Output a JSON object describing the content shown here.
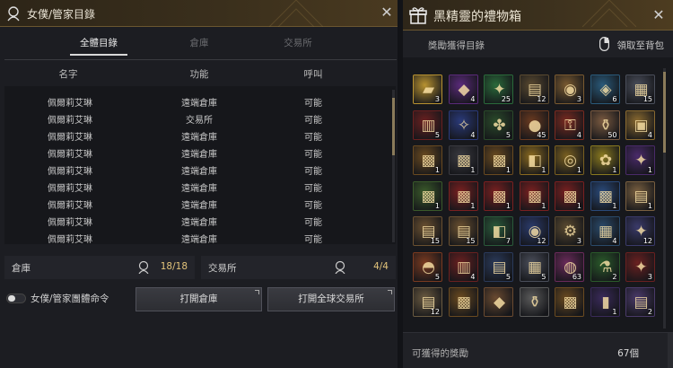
{
  "left_panel": {
    "title": "女僕/管家目錄",
    "close_label": "✕",
    "tabs": [
      {
        "label": "全體目錄",
        "active": true
      },
      {
        "label": "倉庫",
        "active": false
      },
      {
        "label": "交易所",
        "active": false
      }
    ],
    "columns": [
      "名字",
      "功能",
      "呼叫"
    ],
    "rows": [
      {
        "name": "佩爾莉艾琳",
        "function": "遠端倉庫",
        "call": "可能"
      },
      {
        "name": "佩爾莉艾琳",
        "function": "交易所",
        "call": "可能"
      },
      {
        "name": "佩爾莉艾琳",
        "function": "遠端倉庫",
        "call": "可能"
      },
      {
        "name": "佩爾莉艾琳",
        "function": "遠端倉庫",
        "call": "可能"
      },
      {
        "name": "佩爾莉艾琳",
        "function": "遠端倉庫",
        "call": "可能"
      },
      {
        "name": "佩爾莉艾琳",
        "function": "遠端倉庫",
        "call": "可能"
      },
      {
        "name": "佩爾莉艾琳",
        "function": "遠端倉庫",
        "call": "可能"
      },
      {
        "name": "佩爾莉艾琳",
        "function": "遠端倉庫",
        "call": "可能"
      },
      {
        "name": "佩爾莉艾琳",
        "function": "遠端倉庫",
        "call": "可能"
      }
    ],
    "storage_stat": {
      "label": "倉庫",
      "value": "18/18"
    },
    "market_stat": {
      "label": "交易所",
      "value": "4/4"
    },
    "toggle_label": "女僕/管家團體命令",
    "toggle_on": false,
    "open_storage_button": "打開倉庫",
    "open_market_button": "打開全球交易所"
  },
  "right_panel": {
    "title": "黑精靈的禮物箱",
    "close_label": "✕",
    "subtitle": "獎勵獲得目錄",
    "collect_label": "領取至背包",
    "footer_label": "可獲得的獎勵",
    "footer_count": "67個",
    "items": [
      {
        "icon": "gold-bar-icon",
        "count": "3",
        "color": "#b89230",
        "sym": "▰"
      },
      {
        "icon": "purple-pouch-icon",
        "count": "4",
        "color": "#5a2a7a",
        "sym": "◆"
      },
      {
        "icon": "green-crystal-icon",
        "count": "25",
        "color": "#2a6a3a",
        "sym": "✦"
      },
      {
        "icon": "scroll-icon",
        "count": "12",
        "color": "#5a4a30",
        "sym": "▤"
      },
      {
        "icon": "food-tray-icon",
        "count": "3",
        "color": "#7a5a30",
        "sym": "◉"
      },
      {
        "icon": "blue-gem-icon",
        "count": "6",
        "color": "#2a5a7a",
        "sym": "◈"
      },
      {
        "icon": "silver-chest-icon",
        "count": "15",
        "color": "#4a4e5a",
        "sym": "▦"
      },
      {
        "icon": "red-book-icon",
        "count": "5",
        "color": "#6a2020",
        "sym": "▥"
      },
      {
        "icon": "butterfly-icon",
        "count": "4",
        "color": "#2a3a7a",
        "sym": "✧"
      },
      {
        "icon": "green-card-icon",
        "count": "5",
        "color": "#2a4a2a",
        "sym": "✤"
      },
      {
        "icon": "brown-ball-icon",
        "count": "45",
        "color": "#6a3a20",
        "sym": "●"
      },
      {
        "icon": "red-key-icon",
        "count": "4",
        "color": "#7a2a20",
        "sym": "⚿"
      },
      {
        "icon": "jar-icon",
        "count": "50",
        "color": "#7a5a40",
        "sym": "⚱"
      },
      {
        "icon": "golden-box-icon",
        "count": "4",
        "color": "#8a6a30",
        "sym": "▣"
      },
      {
        "icon": "treasure-chest-icon",
        "count": "1",
        "color": "#6a4a20",
        "sym": "▩"
      },
      {
        "icon": "dark-chest-icon",
        "count": "1",
        "color": "#3a3a40",
        "sym": "▩"
      },
      {
        "icon": "treasure-chest-icon",
        "count": "1",
        "color": "#6a4a20",
        "sym": "▩"
      },
      {
        "icon": "gift-box-icon",
        "count": "1",
        "color": "#8a6a20",
        "sym": "◧"
      },
      {
        "icon": "gold-coin-icon",
        "count": "1",
        "color": "#7a6020",
        "sym": "◎"
      },
      {
        "icon": "butterfly-coin-icon",
        "count": "1",
        "color": "#8a7a20",
        "sym": "✿"
      },
      {
        "icon": "purple-card-icon",
        "count": "1",
        "color": "#4a2a6a",
        "sym": "✦"
      },
      {
        "icon": "green-chest-icon",
        "count": "1",
        "color": "#3a5a2a",
        "sym": "▩"
      },
      {
        "icon": "red-chest-icon",
        "count": "1",
        "color": "#7a2020",
        "sym": "▩"
      },
      {
        "icon": "red-chest-icon",
        "count": "1",
        "color": "#7a2020",
        "sym": "▩"
      },
      {
        "icon": "red-chest-icon",
        "count": "1",
        "color": "#7a2020",
        "sym": "▩"
      },
      {
        "icon": "red-chest-icon",
        "count": "1",
        "color": "#7a2020",
        "sym": "▩"
      },
      {
        "icon": "blue-chest-icon",
        "count": "1",
        "color": "#2a4a7a",
        "sym": "▩"
      },
      {
        "icon": "parchment-icon",
        "count": "1",
        "color": "#7a6040",
        "sym": "▤"
      },
      {
        "icon": "parchment-icon",
        "count": "15",
        "color": "#6a5030",
        "sym": "▤"
      },
      {
        "icon": "parchment-icon",
        "count": "15",
        "color": "#6a5030",
        "sym": "▤"
      },
      {
        "icon": "green-gift-icon",
        "count": "7",
        "color": "#2a5a3a",
        "sym": "◧"
      },
      {
        "icon": "blue-orb-icon",
        "count": "12",
        "color": "#2a3a6a",
        "sym": "◉"
      },
      {
        "icon": "gear-icon",
        "count": "3",
        "color": "#5a4a30",
        "sym": "⚙"
      },
      {
        "icon": "blue-crate-icon",
        "count": "4",
        "color": "#2a4a6a",
        "sym": "▦"
      },
      {
        "icon": "blue-crystal-icon",
        "count": "12",
        "color": "#3a3a6a",
        "sym": "✦"
      },
      {
        "icon": "food-icon",
        "count": "5",
        "color": "#7a3a20",
        "sym": "◓"
      },
      {
        "icon": "red-book-icon",
        "count": "4",
        "color": "#6a2020",
        "sym": "▥"
      },
      {
        "icon": "blue-scroll-icon",
        "count": "5",
        "color": "#2a3a5a",
        "sym": "▤"
      },
      {
        "icon": "silver-chest-icon",
        "count": "5",
        "color": "#4a4e5a",
        "sym": "▦"
      },
      {
        "icon": "pink-orb-icon",
        "count": "63",
        "color": "#6a2a5a",
        "sym": "◍"
      },
      {
        "icon": "green-potion-icon",
        "count": "2",
        "color": "#2a5a2a",
        "sym": "⚗"
      },
      {
        "icon": "red-crystal-icon",
        "count": "3",
        "color": "#6a2020",
        "sym": "✦"
      },
      {
        "icon": "map-icon",
        "count": "12",
        "color": "#6a5a40",
        "sym": "▤"
      },
      {
        "icon": "treasure-chest-icon",
        "count": "",
        "color": "#6a4a20",
        "sym": "▩"
      },
      {
        "icon": "brown-pouch-icon",
        "count": "",
        "color": "#6a4a30",
        "sym": "◆"
      },
      {
        "icon": "vase-icon",
        "count": "",
        "color": "#5a5a5a",
        "sym": "⚱"
      },
      {
        "icon": "treasure-chest-icon",
        "count": "",
        "color": "#6a4a20",
        "sym": "▩"
      },
      {
        "icon": "purple-pillar-icon",
        "count": "1",
        "color": "#3a2a5a",
        "sym": "▮"
      },
      {
        "icon": "purple-scroll-icon",
        "count": "2",
        "color": "#4a3a6a",
        "sym": "▤"
      }
    ]
  }
}
